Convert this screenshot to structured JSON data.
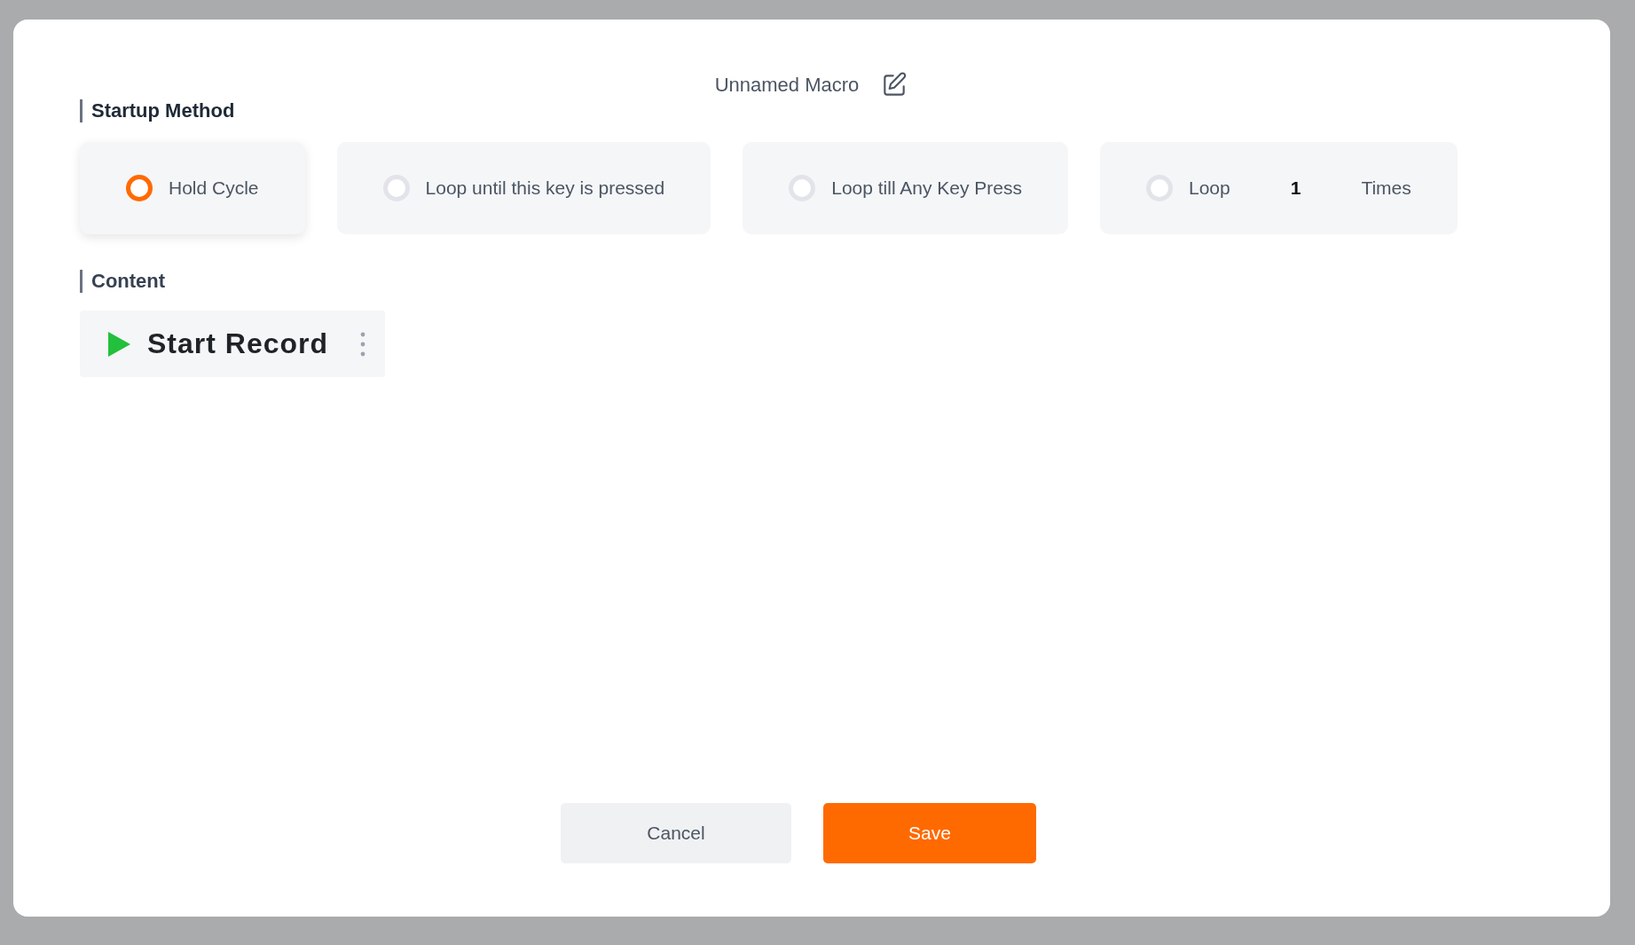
{
  "dialog": {
    "title": "Unnamed Macro"
  },
  "startup_method": {
    "heading": "Startup Method",
    "options": [
      {
        "kind": "plain",
        "label": "Hold Cycle",
        "selected": true
      },
      {
        "kind": "plain",
        "label": "Loop until this key is pressed",
        "selected": false
      },
      {
        "kind": "plain",
        "label": "Loop till Any Key Press",
        "selected": false
      },
      {
        "kind": "count",
        "label": "Loop",
        "value": "1",
        "suffix": "Times",
        "selected": false
      }
    ]
  },
  "content": {
    "heading": "Content",
    "record_button": "Start Record"
  },
  "buttons": [
    {
      "kind": "secondary",
      "label": "Cancel"
    },
    {
      "kind": "primary",
      "label": "Save"
    }
  ]
}
